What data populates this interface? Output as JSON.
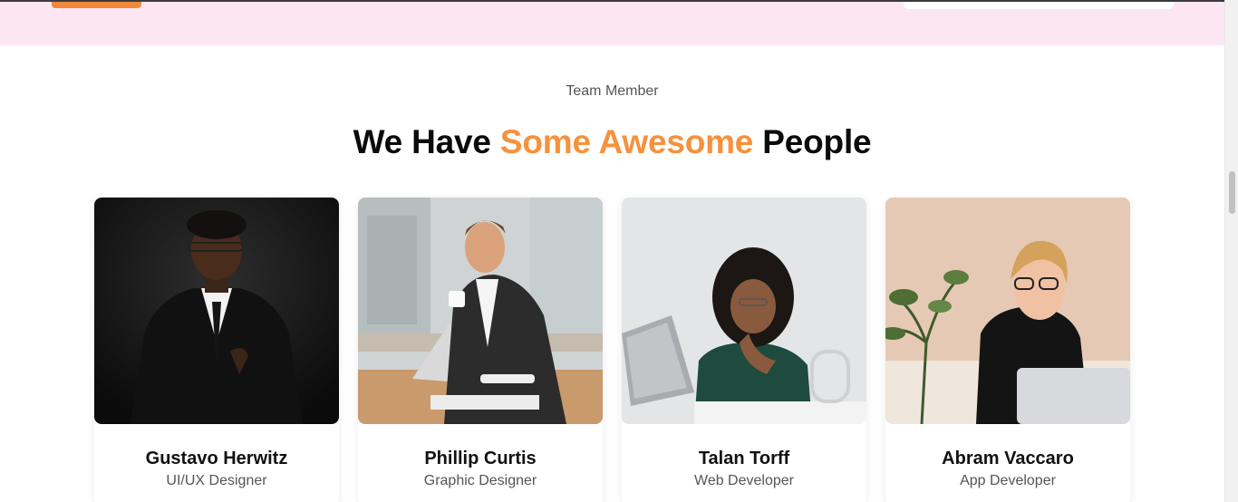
{
  "section": {
    "eyebrow": "Team Member",
    "heading_before": "We Have",
    "heading_accent": "Some Awesome",
    "heading_after": "People"
  },
  "colors": {
    "accent": "#f6913d",
    "hero_band": "#fce6f1",
    "heading": "#0b0b0b",
    "subtext": "#555555"
  },
  "team": [
    {
      "name": "Gustavo Herwitz",
      "role": "UI/UX Designer",
      "photo": "man-black-suit-photo"
    },
    {
      "name": "Phillip Curtis",
      "role": "Graphic Designer",
      "photo": "man-office-coffee-photo"
    },
    {
      "name": "Talan Torff",
      "role": "Web Developer",
      "photo": "woman-laptop-photo"
    },
    {
      "name": "Abram Vaccaro",
      "role": "App Developer",
      "photo": "woman-glasses-photo"
    }
  ]
}
